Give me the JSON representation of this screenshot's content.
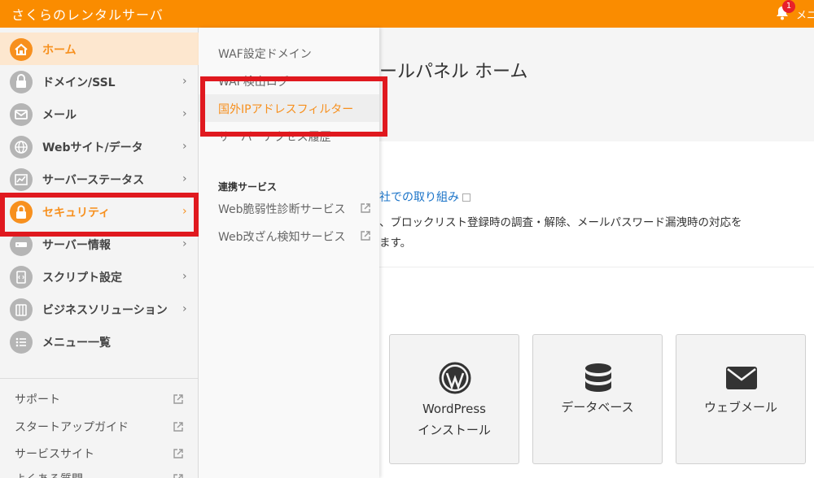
{
  "header": {
    "brand": "さくらのレンタルサーバ",
    "notification_count": "1",
    "menu_label": "メニュー"
  },
  "sidebar": {
    "items": [
      {
        "label": "ホーム",
        "icon": "home-icon"
      },
      {
        "label": "ドメイン/SSL",
        "icon": "domain-icon"
      },
      {
        "label": "メール",
        "icon": "mail-icon"
      },
      {
        "label": "Webサイト/データ",
        "icon": "globe-icon"
      },
      {
        "label": "サーバーステータス",
        "icon": "chart-icon"
      },
      {
        "label": "セキュリティ",
        "icon": "lock-icon"
      },
      {
        "label": "サーバー情報",
        "icon": "server-icon"
      },
      {
        "label": "スクリプト設定",
        "icon": "script-icon"
      },
      {
        "label": "ビジネスソリューション",
        "icon": "business-icon"
      },
      {
        "label": "メニュー一覧",
        "icon": "list-icon"
      }
    ],
    "chevron": "›",
    "links": [
      {
        "label": "サポート"
      },
      {
        "label": "スタートアップガイド"
      },
      {
        "label": "サービスサイト"
      },
      {
        "label": "よくある質問"
      }
    ]
  },
  "flyout": {
    "items": [
      {
        "label": "WAF設定ドメイン"
      },
      {
        "label": "WAF検出ログ"
      },
      {
        "label": "国外IPアドレスフィルター"
      },
      {
        "label": "サーバーアクセス履歴"
      }
    ],
    "partner_heading": "連携サービス",
    "partner_items": [
      {
        "label": "Web脆弱性診断サービス"
      },
      {
        "label": "Web改ざん検知サービス"
      }
    ]
  },
  "main": {
    "page_title": "ールパネル ホーム",
    "info_link": "社での取り組み",
    "info_line1": "、ブロックリスト登録時の調査・解除、メールパスワード漏洩時の対応を",
    "info_line2": "ます。",
    "tiles": [
      {
        "line1": "WordPress",
        "line2": "インストール",
        "icon": "wordpress-icon"
      },
      {
        "line1": "データベース",
        "line2": "",
        "icon": "database-icon"
      },
      {
        "line1": "ウェブメール",
        "line2": "",
        "icon": "envelope-icon"
      }
    ]
  },
  "colors": {
    "brand_orange": "#fa8c00",
    "accent_orange": "#f7901e",
    "highlight_red": "#e0191f",
    "link_blue": "#1a73c8"
  }
}
